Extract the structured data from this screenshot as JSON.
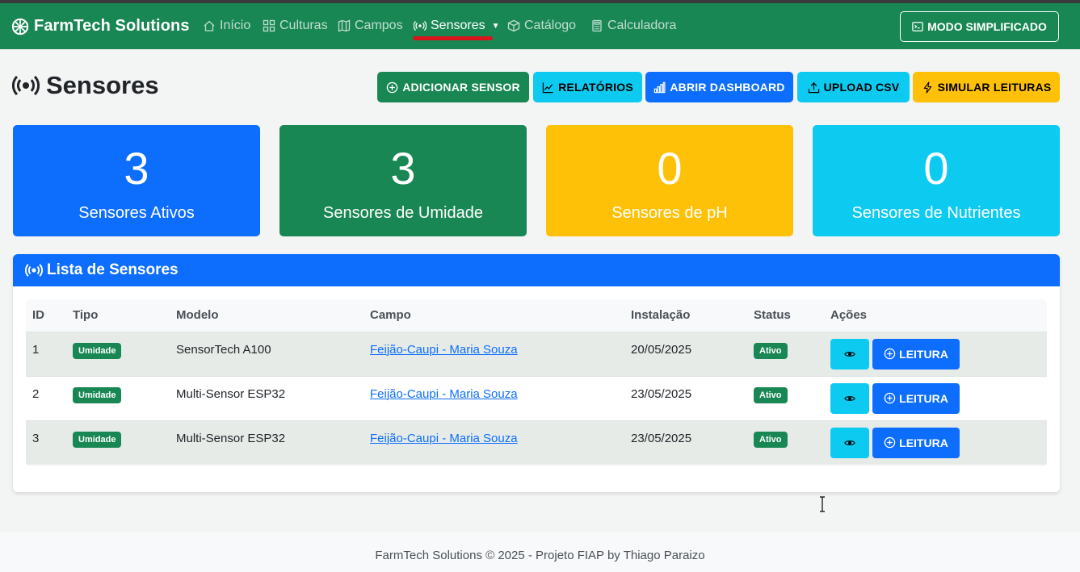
{
  "brand": {
    "name": "FarmTech Solutions",
    "icon": "gear-icon"
  },
  "nav": {
    "items": [
      {
        "label": "Início",
        "icon": "home-icon"
      },
      {
        "label": "Culturas",
        "icon": "grid-icon"
      },
      {
        "label": "Campos",
        "icon": "map-icon"
      },
      {
        "label": "Sensores",
        "icon": "broadcast-icon"
      },
      {
        "label": "Catálogo",
        "icon": "box-icon"
      },
      {
        "label": "Calculadora",
        "icon": "calculator-icon"
      }
    ],
    "active": "Sensores",
    "mode_button": "MODO SIMPLIFICADO"
  },
  "page": {
    "title": "Sensores",
    "actions": {
      "add": "ADICIONAR SENSOR",
      "reports": "RELATÓRIOS",
      "dashboard": "ABRIR DASHBOARD",
      "upload": "UPLOAD CSV",
      "simulate": "SIMULAR LEITURAS"
    }
  },
  "stats": [
    {
      "value": "3",
      "label": "Sensores Ativos"
    },
    {
      "value": "3",
      "label": "Sensores de Umidade"
    },
    {
      "value": "0",
      "label": "Sensores de pH"
    },
    {
      "value": "0",
      "label": "Sensores de Nutrientes"
    }
  ],
  "list": {
    "title": "Lista de Sensores",
    "columns": [
      "ID",
      "Tipo",
      "Modelo",
      "Campo",
      "Instalação",
      "Status",
      "Ações"
    ],
    "rows": [
      {
        "id": "1",
        "tipo": "Umidade",
        "modelo": "SensorTech A100",
        "campo": "Feijão-Caupi - Maria Souza",
        "instalacao": "20/05/2025",
        "status": "Ativo",
        "leitura": "LEITURA"
      },
      {
        "id": "2",
        "tipo": "Umidade",
        "modelo": "Multi-Sensor ESP32",
        "campo": "Feijão-Caupi - Maria Souza",
        "instalacao": "23/05/2025",
        "status": "Ativo",
        "leitura": "LEITURA"
      },
      {
        "id": "3",
        "tipo": "Umidade",
        "modelo": "Multi-Sensor ESP32",
        "campo": "Feijão-Caupi - Maria Souza",
        "instalacao": "23/05/2025",
        "status": "Ativo",
        "leitura": "LEITURA"
      }
    ]
  },
  "footer": {
    "text": "FarmTech Solutions © 2025 - Projeto FIAP by Thiago Paraizo"
  },
  "colors": {
    "primary": "#0d6efd",
    "success": "#198754",
    "warning": "#ffc107",
    "info": "#0dcaf0",
    "active_indicator": "#d9151b"
  }
}
